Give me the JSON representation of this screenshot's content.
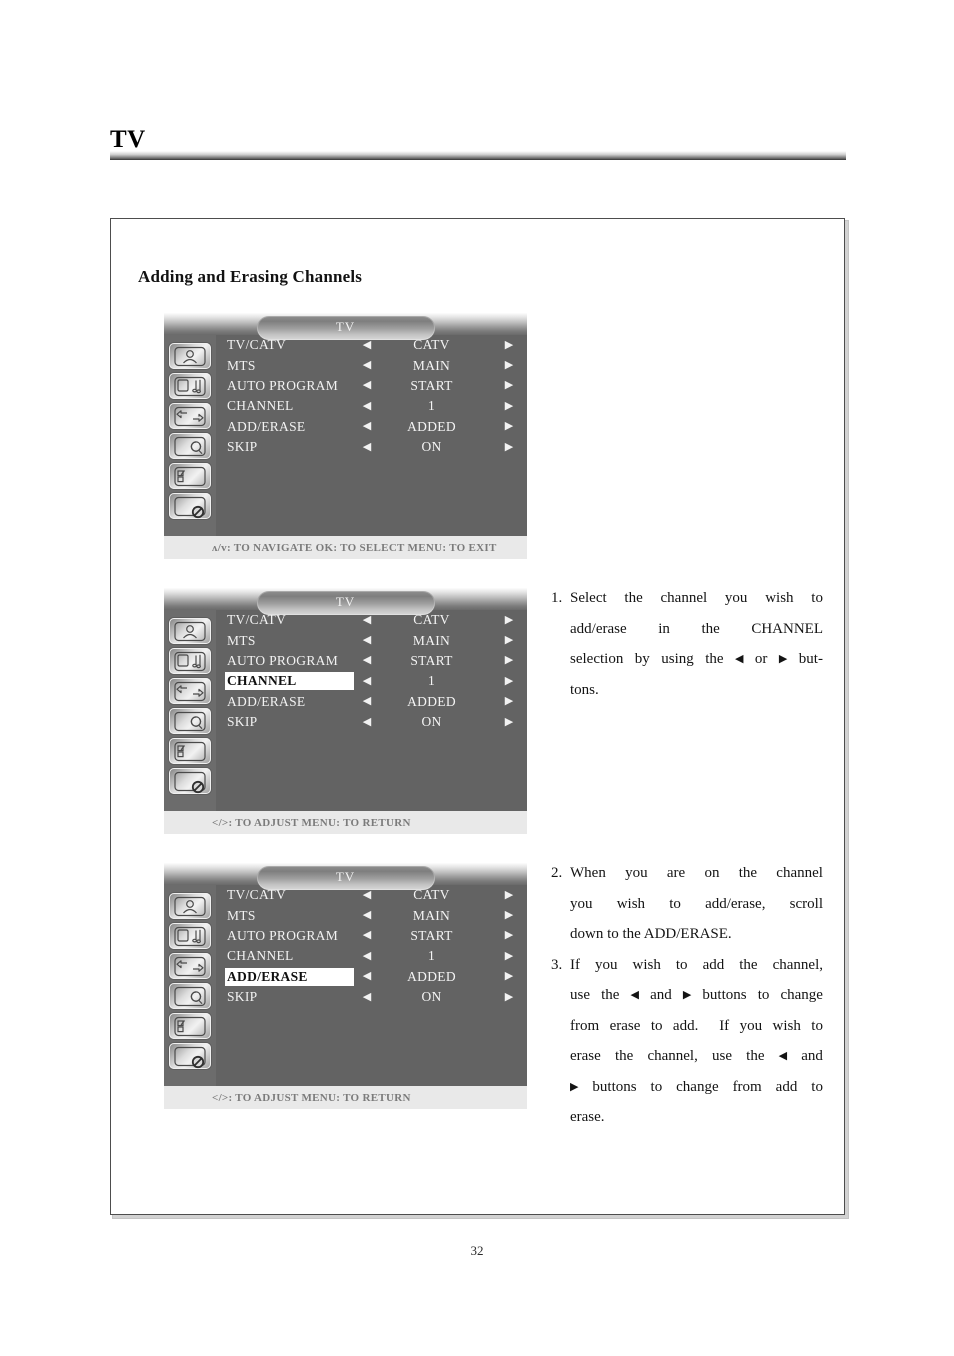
{
  "page": {
    "header_title": "TV",
    "section_title": "Adding and Erasing Channels",
    "page_number": "32"
  },
  "colors": {
    "osd_background": "#636363",
    "osd_rail": "#6c6c6c",
    "osd_footer": "#e9e9e9",
    "osd_footer_text": "#7b7b7b",
    "highlight_background": "#ffffff",
    "highlight_text": "#101010",
    "osd_text": "#f2f2f2"
  },
  "osd_common": {
    "title": "TV",
    "left_arrow": "◀",
    "right_arrow": "▶",
    "rail_icons": [
      "picture-settings-icon",
      "audio-settings-icon",
      "channel-settings-icon",
      "setup-reset-icon",
      "parental-lock-icon",
      "no-signal-icon"
    ],
    "rows": [
      {
        "label": "TV/CATV",
        "value": "CATV"
      },
      {
        "label": "MTS",
        "value": "MAIN"
      },
      {
        "label": "AUTO PROGRAM",
        "value": "START"
      },
      {
        "label": "CHANNEL",
        "value": "1"
      },
      {
        "label": "ADD/ERASE",
        "value": "ADDED"
      },
      {
        "label": "SKIP",
        "value": "ON"
      }
    ]
  },
  "osd_panels": [
    {
      "id": "osd-panel-1",
      "selected_row": -1,
      "footer": "ʌ/v: TO NAVIGATE   OK: TO SELECT   MENU: TO EXIT"
    },
    {
      "id": "osd-panel-2",
      "selected_row": 3,
      "footer": "</>: TO ADJUST   MENU: TO RETURN"
    },
    {
      "id": "osd-panel-3",
      "selected_row": 4,
      "footer": "</>: TO ADJUST   MENU: TO RETURN"
    }
  ],
  "instructions": [
    {
      "number": "1.",
      "lines": [
        "Select the channel you wish to",
        "add/erase in the CHANNEL",
        "selection by using the ◀ or ▶ but-",
        "tons."
      ]
    },
    {
      "number": "2.",
      "lines": [
        "When you are on the channel",
        "you wish to add/erase, scroll",
        "down to the ADD/ERASE."
      ]
    },
    {
      "number": "3.",
      "lines": [
        "If you wish to add the channel,",
        "use the ◀ and ▶ buttons to change",
        "from erase to add.  If you wish to",
        "erase the channel, use the ◀ and",
        "▶ buttons to change from add to",
        "erase."
      ]
    }
  ]
}
